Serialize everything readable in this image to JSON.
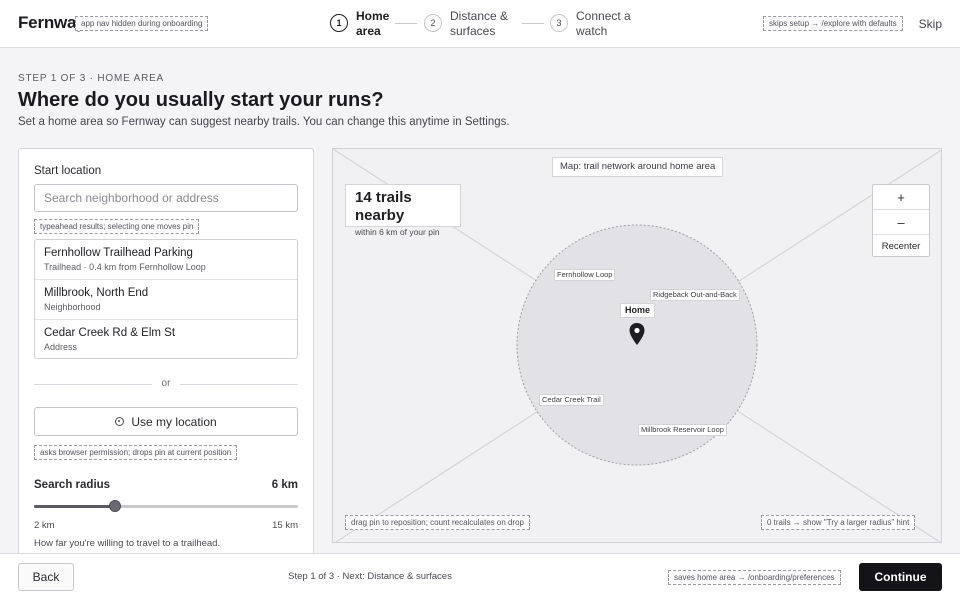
{
  "nav": {
    "logo": "Fernway",
    "logo_note": "app nav hidden during onboarding",
    "steps": [
      {
        "num": "1",
        "label": "Home area"
      },
      {
        "num": "2",
        "label": "Distance & surfaces"
      },
      {
        "num": "3",
        "label": "Connect a watch"
      }
    ],
    "skip_note": "skips setup → /explore with defaults",
    "skip_label": "Skip"
  },
  "header": {
    "eyebrow": "STEP 1 OF 3 · HOME AREA",
    "title": "Where do you usually start your runs?",
    "subtitle": "Set a home area so Fernway can suggest nearby trails. You can change this anytime in Settings."
  },
  "start": {
    "label": "Start location",
    "placeholder": "Search neighborhood or address",
    "typeahead_note": "typeahead results; selecting one moves pin",
    "results": [
      {
        "title": "Fernhollow Trailhead Parking",
        "sub": "Trailhead · 0.4 km from Fernhollow Loop"
      },
      {
        "title": "Millbrook, North End",
        "sub": "Neighborhood"
      },
      {
        "title": "Cedar Creek Rd & Elm St",
        "sub": "Address"
      }
    ],
    "or_label": "or",
    "use_location_label": "Use my location",
    "location_note": "asks browser permission; drops pin at current position"
  },
  "radius": {
    "label": "Search radius",
    "value_label": "6 km",
    "value": 6,
    "min": 2,
    "max": 15,
    "min_label": "2 km",
    "max_label": "15 km",
    "help": "How far you're willing to travel to a trailhead."
  },
  "map": {
    "caption": "Map: trail network around home area",
    "count_title": "14 trails nearby",
    "count_desc": "within 6 km of your pin",
    "zoom_in": "+",
    "zoom_out": "–",
    "recenter": "Recenter",
    "trails": [
      "Fernhollow Loop",
      "Ridgeback Out-and-Back",
      "Cedar Creek Trail",
      "Millbrook Reservoir Loop"
    ],
    "home_label": "Home",
    "drag_note": "drag pin to reposition; count recalculates on drop",
    "zero_note": "0 trails → show \"Try a larger radius\" hint"
  },
  "footer": {
    "back_label": "Back",
    "step_text": "Step 1 of 3 · Next: Distance & surfaces",
    "save_note": "saves home area → /onboarding/preferences",
    "continue_label": "Continue"
  }
}
